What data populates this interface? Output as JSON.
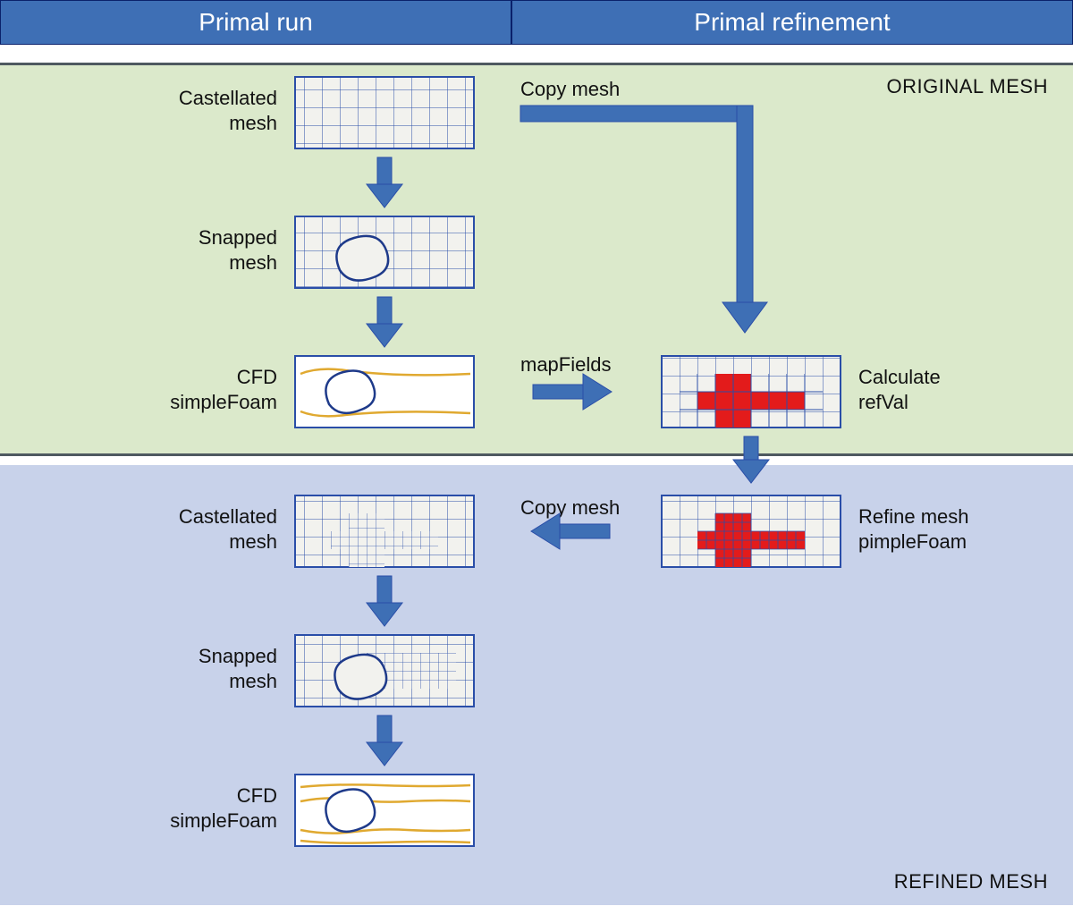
{
  "headers": {
    "left": "Primal run",
    "right": "Primal refinement"
  },
  "regions": {
    "top_label": "ORIGINAL MESH",
    "bottom_label": "REFINED MESH"
  },
  "labels": {
    "castellated_mesh_1a": "Castellated",
    "castellated_mesh_1b": "mesh",
    "snapped_mesh_1a": "Snapped",
    "snapped_mesh_1b": "mesh",
    "cfd_1a": "CFD",
    "cfd_1b": "simpleFoam",
    "copy_mesh_1": "Copy mesh",
    "map_fields": "mapFields",
    "calculate_a": "Calculate",
    "calculate_b": "refVal",
    "refine_a": "Refine mesh",
    "refine_b": "pimpleFoam",
    "copy_mesh_2": "Copy mesh",
    "castellated_mesh_2a": "Castellated",
    "castellated_mesh_2b": "mesh",
    "snapped_mesh_2a": "Snapped",
    "snapped_mesh_2b": "mesh",
    "cfd_2a": "CFD",
    "cfd_2b": "simpleFoam"
  }
}
